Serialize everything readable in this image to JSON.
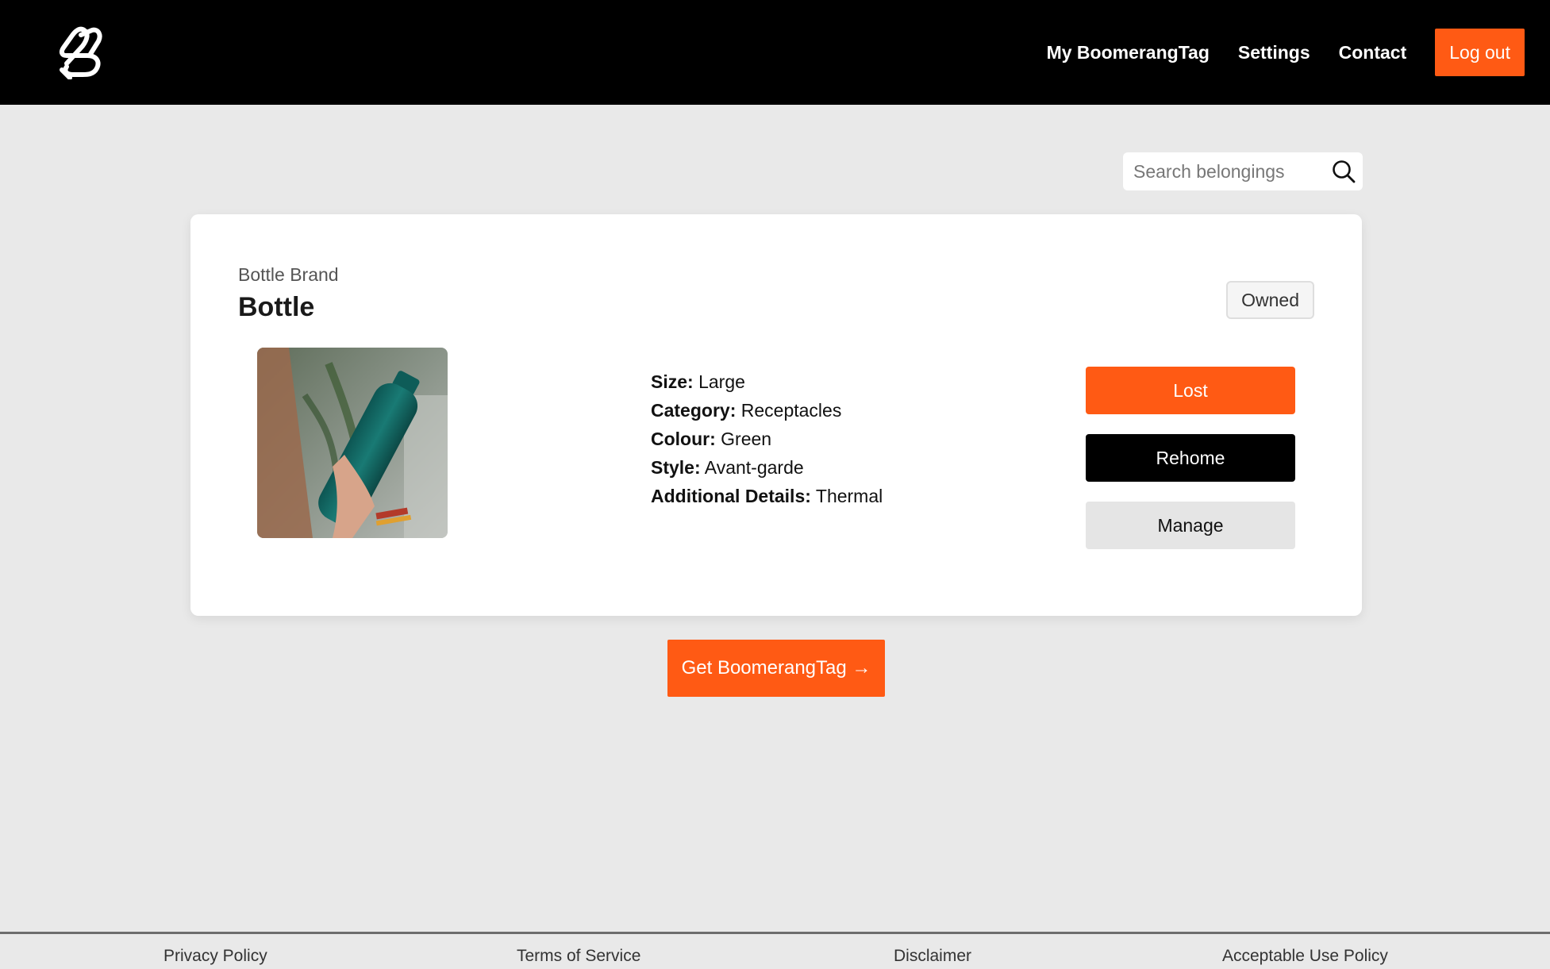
{
  "header": {
    "logo_icon": "boomerang-logo-icon",
    "nav": [
      {
        "label": "My BoomerangTag"
      },
      {
        "label": "Settings"
      },
      {
        "label": "Contact"
      }
    ],
    "logout_label": "Log out",
    "accent_color": "#ff5a14"
  },
  "search": {
    "placeholder": "Search belongings",
    "value": "",
    "icon": "search-icon"
  },
  "item": {
    "brand": "Bottle Brand",
    "name": "Bottle",
    "status": "Owned",
    "photo_icon": "bottle-photo",
    "details": [
      {
        "label": "Size:",
        "value": "Large"
      },
      {
        "label": "Category:",
        "value": "Receptacles"
      },
      {
        "label": "Colour:",
        "value": "Green"
      },
      {
        "label": "Style:",
        "value": "Avant-garde"
      },
      {
        "label": "Additional Details:",
        "value": "Thermal"
      }
    ],
    "actions": {
      "lost": "Lost",
      "rehome": "Rehome",
      "manage": "Manage"
    }
  },
  "cta_label": "Get BoomerangTag →",
  "footer": {
    "links": [
      {
        "label": "Privacy Policy"
      },
      {
        "label": "Terms of Service"
      },
      {
        "label": "Disclaimer"
      },
      {
        "label": "Acceptable Use Policy"
      }
    ]
  }
}
